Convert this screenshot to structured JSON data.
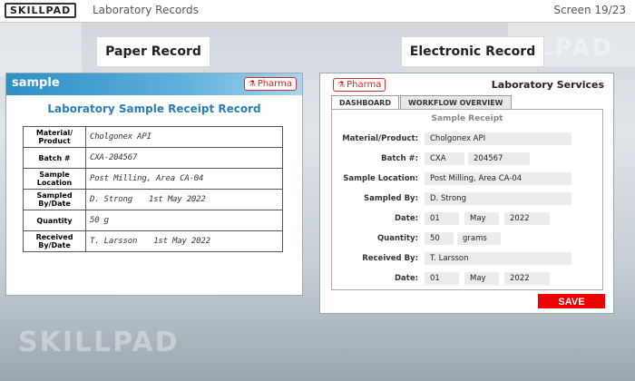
{
  "app": {
    "logo_text": "SKILLPAD",
    "title": "Laboratory Records",
    "screen_counter": "Screen 19/23"
  },
  "headings": {
    "paper": "Paper Record",
    "electronic": "Electronic Record"
  },
  "background": {
    "watermark_text": "SKILLPAD"
  },
  "paper": {
    "header_label": "sample",
    "logo_text": "Pharma",
    "title": "Laboratory Sample Receipt Record",
    "rows": [
      {
        "label": "Material/ Product",
        "value": "Cholgonex API",
        "date": ""
      },
      {
        "label": "Batch #",
        "value": "CXA-204567",
        "date": ""
      },
      {
        "label": "Sample Location",
        "value": "Post Milling, Area CA-04",
        "date": ""
      },
      {
        "label": "Sampled By/Date",
        "value": "D. Strong",
        "date": "1st May 2022"
      },
      {
        "label": "Quantity",
        "value": "50 g",
        "date": ""
      },
      {
        "label": "Received By/Date",
        "value": "T. Larsson",
        "date": "1st May 2022"
      }
    ]
  },
  "electronic": {
    "logo_text": "Pharma",
    "header_title": "Laboratory Services",
    "tabs": [
      "DASHBOARD",
      "WORKFLOW OVERVIEW"
    ],
    "form_title": "Sample Receipt",
    "labels": {
      "material": "Material/Product:",
      "batch": "Batch #:",
      "location": "Sample Location:",
      "sampled_by": "Sampled By:",
      "date1": "Date:",
      "quantity": "Quantity:",
      "received_by": "Received By:",
      "date2": "Date:"
    },
    "values": {
      "material": "Cholgonex API",
      "batch_prefix": "CXA",
      "batch_number": "204567",
      "location": "Post Milling, Area CA-04",
      "sampled_by": "D. Strong",
      "date1_day": "01",
      "date1_month": "May",
      "date1_year": "2022",
      "quantity": "50",
      "quantity_unit": "grams",
      "received_by": "T. Larsson",
      "date2_day": "01",
      "date2_month": "May",
      "date2_year": "2022"
    },
    "save_label": "SAVE"
  },
  "colors": {
    "accent_blue": "#2a7db7",
    "save_red": "#e00000",
    "pharma_red": "#cc2222"
  },
  "icons": {
    "pharma_mark": "flask-icon"
  }
}
